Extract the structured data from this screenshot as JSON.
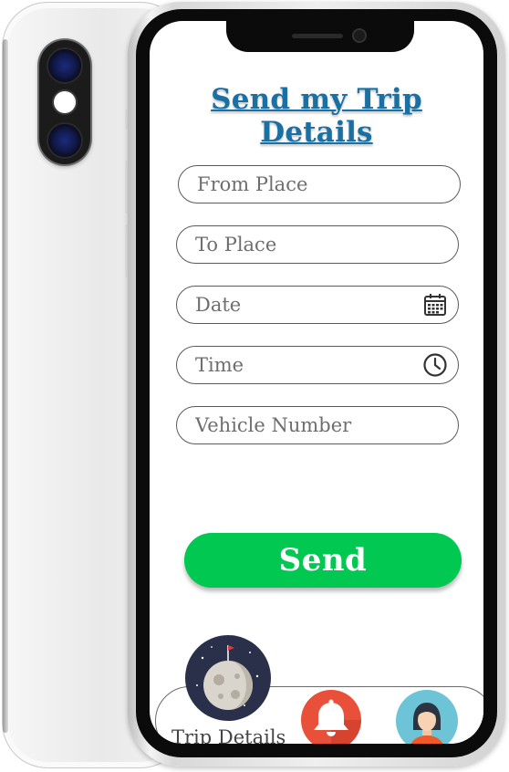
{
  "header": {
    "title": "Send my Trip Details"
  },
  "form": {
    "from_place": {
      "placeholder": "From Place",
      "value": ""
    },
    "to_place": {
      "placeholder": "To Place",
      "value": ""
    },
    "date": {
      "placeholder": "Date",
      "value": "",
      "icon": "calendar-icon"
    },
    "time": {
      "placeholder": "Time",
      "value": "",
      "icon": "clock-icon"
    },
    "vehicle_number": {
      "placeholder": "Vehicle Number",
      "value": ""
    },
    "send_label": "Send"
  },
  "nav": {
    "active_label": "Trip Details",
    "items": [
      {
        "icon": "moon-icon",
        "label": "Trip Details"
      },
      {
        "icon": "bell-icon"
      },
      {
        "icon": "avatar-icon"
      }
    ]
  },
  "colors": {
    "title": "#1a6fa3",
    "send_button": "#00c851",
    "bell": "#e8503a",
    "avatar_bg": "#6cc4d6",
    "moon_bg": "#2a2f4a"
  }
}
